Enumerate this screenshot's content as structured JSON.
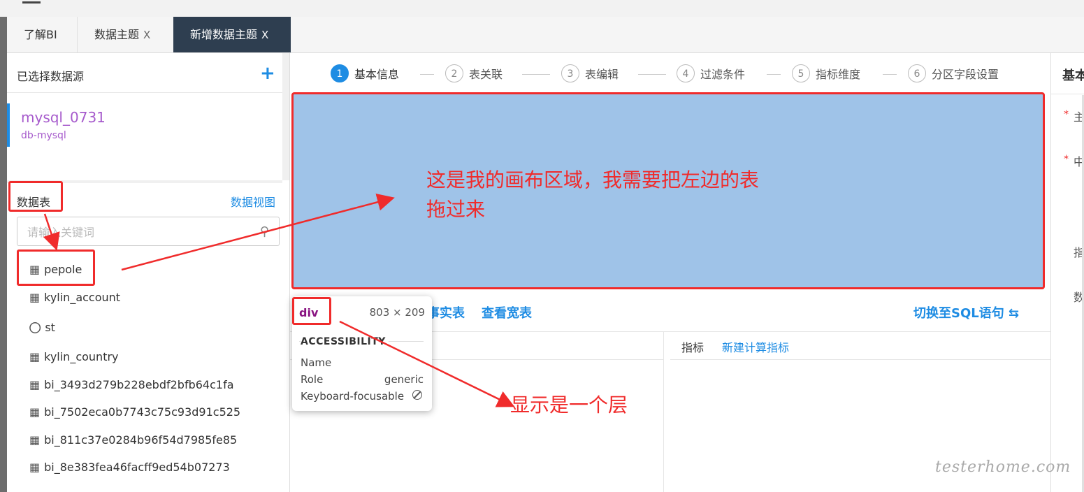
{
  "tabs": [
    {
      "label": "了解BI",
      "closable": false
    },
    {
      "label": "数据主题",
      "closable": true
    },
    {
      "label": "新增数据主题",
      "closable": true,
      "active": true
    }
  ],
  "close_glyph": "X",
  "left_panel": {
    "selected_sources_title": "已选择数据源",
    "add_icon": "plus-icon",
    "datasource": {
      "name": "mysql_0731",
      "type": "db-mysql"
    },
    "tables_title": "数据表",
    "data_view_link": "数据视图",
    "search_placeholder": "请输入关键词",
    "tables": [
      {
        "name": "pepole",
        "icon": "table-icon"
      },
      {
        "name": "kylin_account",
        "icon": "table-icon"
      },
      {
        "name": "st",
        "icon": "view-glasses-icon"
      },
      {
        "name": "kylin_country",
        "icon": "table-icon"
      },
      {
        "name": "bi_3493d279b228ebdf2bfb64c1fa",
        "icon": "table-icon"
      },
      {
        "name": "bi_7502eca0b7743c75c93d91c525",
        "icon": "table-icon"
      },
      {
        "name": "bi_811c37e0284b96f54d7985fe85",
        "icon": "table-icon"
      },
      {
        "name": "bi_8e383fea46facff9ed54b07273",
        "icon": "table-icon"
      }
    ]
  },
  "steps": [
    {
      "num": "1",
      "label": "基本信息",
      "active": true
    },
    {
      "num": "2",
      "label": "表关联"
    },
    {
      "num": "3",
      "label": "表编辑"
    },
    {
      "num": "4",
      "label": "过滤条件"
    },
    {
      "num": "5",
      "label": "指标维度"
    },
    {
      "num": "6",
      "label": "分区字段设置"
    }
  ],
  "canvas_note_line1": "这是我的画布区域，我需要把左边的表",
  "canvas_note_line2": "拖过来",
  "toolbar": {
    "view_fact_partial": "事实表",
    "view_wide": "查看宽表",
    "switch_sql": "切换至SQL语句 ⇆"
  },
  "lower_right": {
    "metric_label": "指标",
    "new_metric_link": "新建计算指标"
  },
  "right_panel": {
    "title_partial": "基本",
    "char1": "主",
    "char2": "中",
    "char3": "指",
    "char4": "数"
  },
  "devtools_tooltip": {
    "tag": "div",
    "size": "803 × 209",
    "section": "ACCESSIBILITY",
    "name_label": "Name",
    "role_label": "Role",
    "role_value": "generic",
    "focus_label": "Keyboard-focusable"
  },
  "annotation_layer": "显示是一个层",
  "watermark": "testerhome.com",
  "colors": {
    "accent": "#1e8ce3",
    "annotation_red": "#f02b2b",
    "canvas_blue": "#9fc3e8",
    "tab_active": "#2e3e50"
  }
}
